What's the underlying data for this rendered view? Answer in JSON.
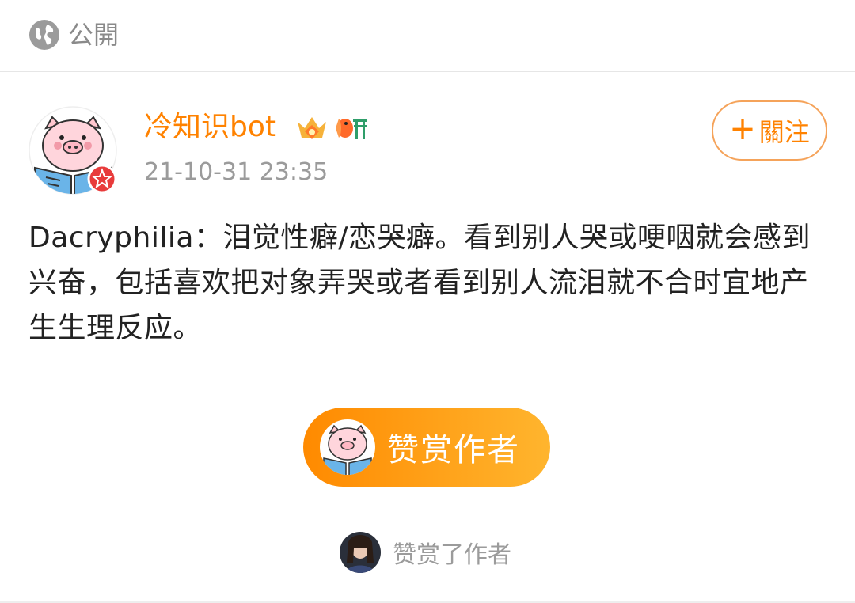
{
  "visibility": {
    "icon": "globe-icon",
    "label": "公開"
  },
  "post": {
    "user": {
      "name": "冷知识bot",
      "avatar": "pig-reading-avatar",
      "badges": [
        "crown-badge-icon",
        "goldfish-badge-icon"
      ]
    },
    "time": "21-10-31 23:35",
    "follow_label": "關注",
    "text": "Dacryphilia：泪觉性癖/恋哭癖。看到别人哭或哽咽就会感到兴奋，包括喜欢把对象弄哭或者看到别人流泪就不合时宜地产生生理反应。"
  },
  "reward": {
    "button_label": "赞赏作者",
    "rewarded_label": "赞赏了作者"
  },
  "colors": {
    "accent": "#ff8200",
    "reward_start": "#ff8a00",
    "reward_end": "#ffb52e",
    "muted": "#9b9b9b"
  }
}
